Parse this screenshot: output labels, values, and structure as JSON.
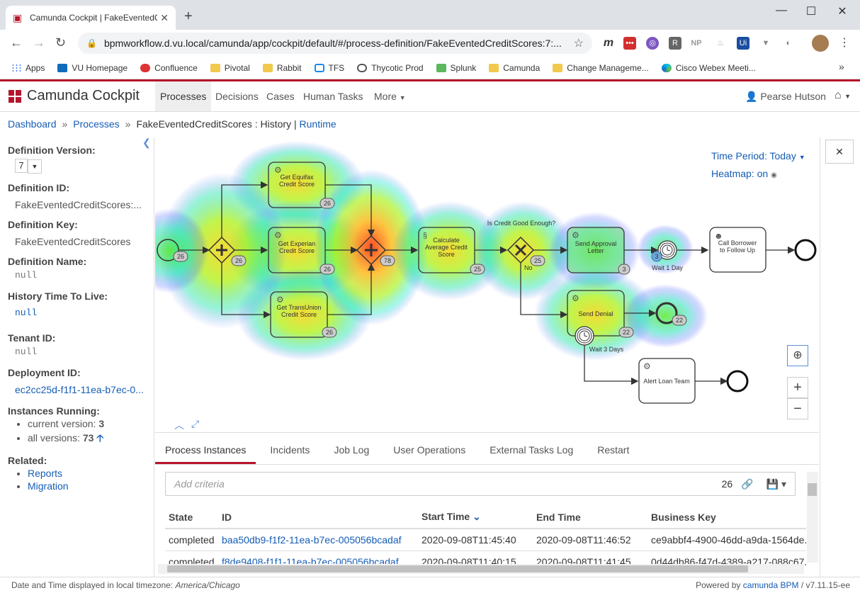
{
  "browser": {
    "tab_title": "Camunda Cockpit | FakeEventedC",
    "url": "bpmworkflow.d.vu.local/camunda/app/cockpit/default/#/process-definition/FakeEventedCreditScores:7:...",
    "bookmarks": [
      {
        "label": "Apps",
        "icon": "apps-icon"
      },
      {
        "label": "VU Homepage",
        "icon": "sharepoint-icon"
      },
      {
        "label": "Confluence",
        "icon": "confluence-icon"
      },
      {
        "label": "Pivotal",
        "icon": "folder-icon"
      },
      {
        "label": "Rabbit",
        "icon": "folder-icon"
      },
      {
        "label": "TFS",
        "icon": "tfs-icon"
      },
      {
        "label": "Thycotic Prod",
        "icon": "thycotic-icon"
      },
      {
        "label": "Splunk",
        "icon": "splunk-icon"
      },
      {
        "label": "Camunda",
        "icon": "folder-icon"
      },
      {
        "label": "Change Manageme...",
        "icon": "folder-icon"
      },
      {
        "label": "Cisco Webex Meeti...",
        "icon": "webex-icon"
      }
    ]
  },
  "header": {
    "brand": "Camunda Cockpit",
    "menu": [
      "Processes",
      "Decisions",
      "Cases",
      "Human Tasks",
      "More"
    ],
    "active_menu": "Processes",
    "user": "Pearse Hutson"
  },
  "breadcrumb": {
    "dashboard": "Dashboard",
    "processes": "Processes",
    "current": "FakeEventedCreditScores : History",
    "separator": "|",
    "runtime": "Runtime"
  },
  "sidebar": {
    "definition_version_label": "Definition Version:",
    "definition_version": "7",
    "definition_id_label": "Definition ID:",
    "definition_id": "FakeEventedCreditScores:...",
    "definition_key_label": "Definition Key:",
    "definition_key": "FakeEventedCreditScores",
    "definition_name_label": "Definition Name:",
    "definition_name": "null",
    "history_ttl_label": "History Time To Live:",
    "history_ttl": "null",
    "tenant_id_label": "Tenant ID:",
    "tenant_id": "null",
    "deployment_id_label": "Deployment ID:",
    "deployment_id": "ec2cc25d-f1f1-11ea-b7ec-0...",
    "instances_label": "Instances Running:",
    "current_version_label": "current version:",
    "current_version": "3",
    "all_versions_label": "all versions:",
    "all_versions": "73",
    "related_label": "Related:",
    "related": [
      "Reports",
      "Migration"
    ]
  },
  "diagram": {
    "time_period": "Time Period: Today",
    "heatmap": "Heatmap: on",
    "tasks": {
      "equifax": "Get Equifax Credit Score",
      "experian": "Get Experian Credit Score",
      "transunion": "Get TransUnion Credit Score",
      "calculate": "Calculate Average Credit Score",
      "approval": "Send Approval Letter",
      "denial": "Send Denial",
      "call": "Call Borrower to Follow Up",
      "alert": "Alert Loan Team"
    },
    "gateway_label": "Is Credit Good Enough?",
    "no_label": "No",
    "timer1": "Wait 1 Day",
    "timer2": "Wait 3 Days",
    "badges": {
      "start": "26",
      "split": "26",
      "equifax": "26",
      "experian": "26",
      "transunion": "26",
      "join": "78",
      "calculate": "25",
      "gateway": "25",
      "approval": "3",
      "timer1": "3",
      "denial": "22",
      "end_denial": "22"
    }
  },
  "tabs": [
    "Process Instances",
    "Incidents",
    "Job Log",
    "User Operations",
    "External Tasks Log",
    "Restart"
  ],
  "active_tab": "Process Instances",
  "filter": {
    "placeholder": "Add criteria",
    "count": "26"
  },
  "table": {
    "headers": [
      "State",
      "ID",
      "Start Time",
      "End Time",
      "Business Key"
    ],
    "rows": [
      [
        "completed",
        "baa50db9-f1f2-11ea-b7ec-005056bcadaf",
        "2020-09-08T11:45:40",
        "2020-09-08T11:46:52",
        "ce9abbf4-4900-46dd-a9da-1564de..."
      ],
      [
        "completed",
        "f8de9408-f1f1-11ea-b7ec-005056bcadaf",
        "2020-09-08T11:40:15",
        "2020-09-08T11:41:45",
        "0d44db86-f47d-4389-a217-088c67..."
      ]
    ]
  },
  "footer": {
    "left_prefix": "Date and Time displayed in local timezone:",
    "timezone": "America/Chicago",
    "right_prefix": "Powered by",
    "product": "camunda BPM",
    "version": "/ v7.11.15-ee"
  },
  "colors": {
    "brand_red": "#b5152b",
    "link_blue": "#155cb5"
  }
}
